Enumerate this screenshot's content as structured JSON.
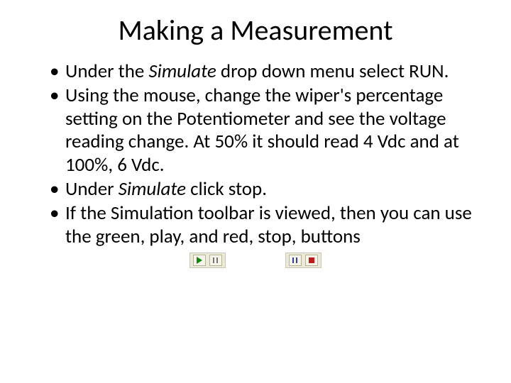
{
  "title": "Making a Measurement",
  "bullets": [
    {
      "pre": "Under the ",
      "em": "Simulate",
      "post": " drop down menu select RUN."
    },
    {
      "pre": "Using the mouse, change the wiper's percentage setting on the Potentiometer and see the voltage reading change.  At 50% it should read 4 Vdc and at 100%, 6 Vdc.",
      "em": "",
      "post": ""
    },
    {
      "pre": "Under ",
      "em": "Simulate",
      "post": " click stop."
    },
    {
      "pre": "If the Simulation toolbar is viewed, then you can use the green, play, and red, stop, buttons",
      "em": "",
      "post": ""
    }
  ],
  "toolbar_left": {
    "buttons": [
      "play",
      "pause"
    ]
  },
  "toolbar_right": {
    "buttons": [
      "pause",
      "stop"
    ]
  }
}
